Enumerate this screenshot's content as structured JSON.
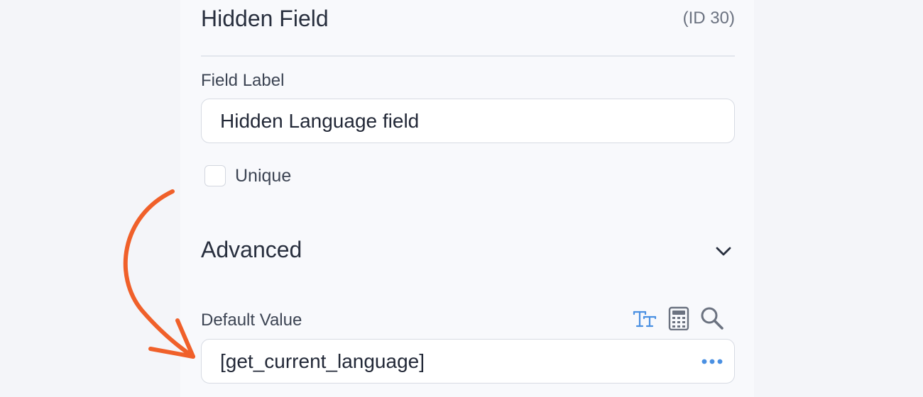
{
  "header": {
    "title": "Hidden Field",
    "id_label": "(ID 30)"
  },
  "field_label": {
    "label": "Field Label",
    "value": "Hidden Language field"
  },
  "unique": {
    "label": "Unique",
    "checked": false
  },
  "advanced": {
    "title": "Advanced",
    "icon": "chevron-down-icon"
  },
  "default_value": {
    "label": "Default Value",
    "value": "[get_current_language]",
    "tools": [
      "text-format-icon",
      "calculator-icon",
      "search-icon"
    ],
    "more_icon": "more-dots-icon"
  },
  "colors": {
    "accent": "#4a90e2",
    "arrow": "#f0602a",
    "text": "#282f3e"
  }
}
